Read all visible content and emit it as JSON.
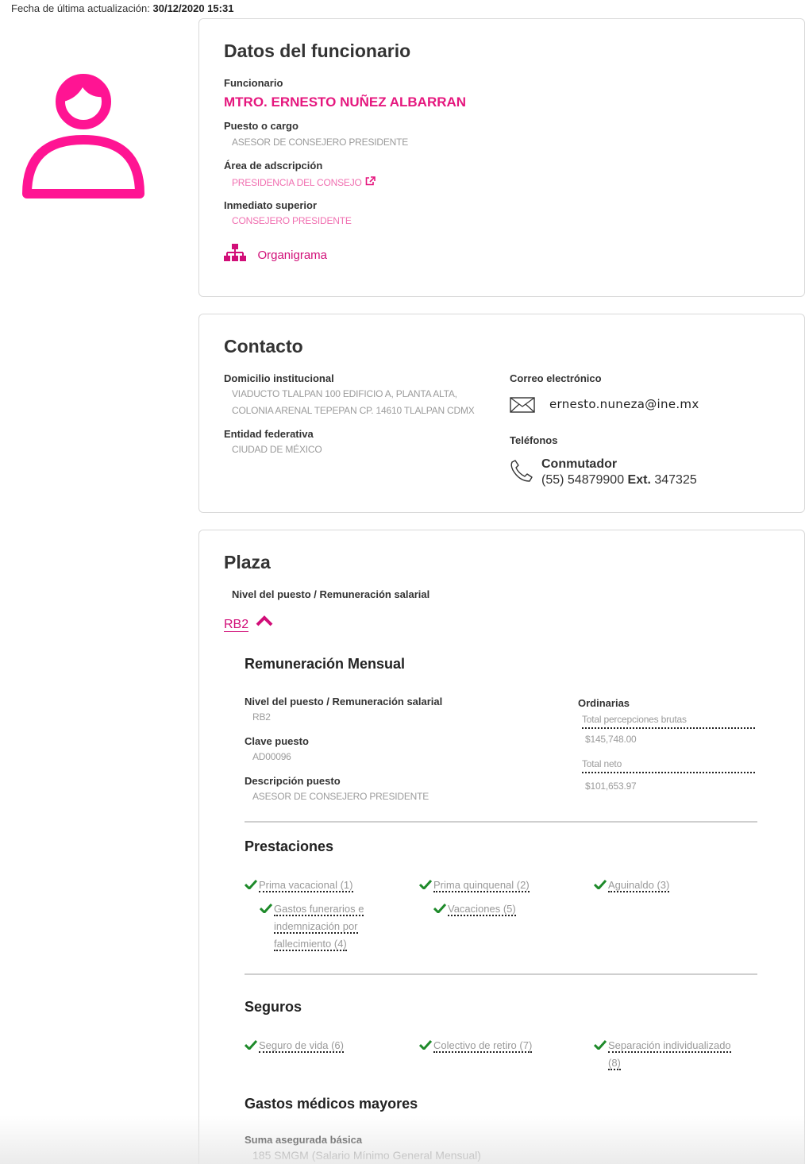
{
  "header": {
    "updated_label": "Fecha de última actualización:",
    "updated_value": "30/12/2020 15:31"
  },
  "colors": {
    "accent": "#e5177e",
    "check": "#2e9a2e",
    "muted": "#9b9b9b"
  },
  "datos": {
    "title": "Datos del funcionario",
    "funcionario_label": "Funcionario",
    "funcionario_name": "MTRO. ERNESTO NUÑEZ ALBARRAN",
    "puesto_label": "Puesto o cargo",
    "puesto_value": "ASESOR DE CONSEJERO PRESIDENTE",
    "area_label": "Área de adscripción",
    "area_value": "PRESIDENCIA DEL CONSEJO",
    "superior_label": "Inmediato superior",
    "superior_value": "CONSEJERO PRESIDENTE",
    "org_link": "Organigrama"
  },
  "contacto": {
    "title": "Contacto",
    "domicilio_label": "Domicilio institucional",
    "domicilio_line1": "VIADUCTO TLALPAN 100 EDIFICIO A, PLANTA ALTA,",
    "domicilio_line2": "COLONIA ARENAL TEPEPAN CP. 14610 TLALPAN CDMX",
    "entidad_label": "Entidad federativa",
    "entidad_value": "CIUDAD DE MÉXICO",
    "correo_label": "Correo electrónico",
    "correo_value": "ernesto.nuneza@ine.mx",
    "telefonos_label": "Teléfonos",
    "conmutador_label": "Conmutador",
    "phone_number": "(55) 54879900",
    "ext_label": "Ext.",
    "ext_value": "347325"
  },
  "plaza": {
    "title": "Plaza",
    "nivel_header": "Nivel del puesto / Remuneración salarial",
    "level_link": "RB2",
    "remuneracion_title": "Remuneración Mensual",
    "nivel_label": "Nivel del puesto / Remuneración salarial",
    "nivel_value": "RB2",
    "clave_label": "Clave puesto",
    "clave_value": "AD00096",
    "descripcion_label": "Descripción puesto",
    "descripcion_value": "ASESOR DE CONSEJERO PRESIDENTE",
    "ordinarias_label": "Ordinarias",
    "brutas_label": "Total percepciones brutas",
    "brutas_value": "$145,748.00",
    "neto_label": "Total neto",
    "neto_value": "$101,653.97",
    "prestaciones_title": "Prestaciones",
    "prestaciones": [
      "Prima vacacional (1)",
      "Prima quinquenal (2)",
      "Aguinaldo (3)",
      "Gastos funerarios e",
      "indemnización por",
      "fallecimiento (4)",
      "Vacaciones (5)"
    ],
    "seguros_title": "Seguros",
    "seguros": [
      "Seguro de vida (6)",
      "Colectivo de retiro (7)",
      "Separación individualizado",
      "(8)"
    ],
    "gmm_title": "Gastos médicos mayores",
    "suma_label": "Suma asegurada básica",
    "suma_value": "185 SMGM (Salario Mínimo General Mensual)"
  }
}
